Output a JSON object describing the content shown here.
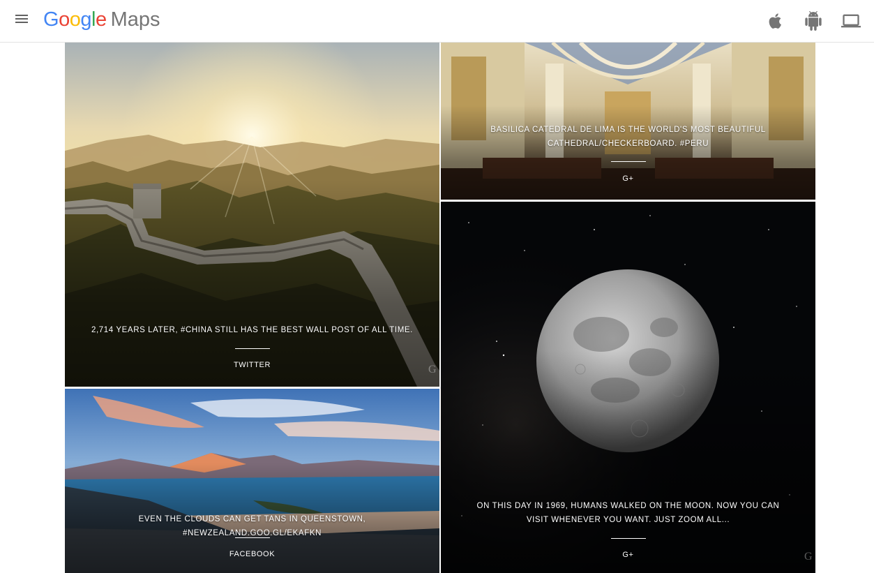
{
  "header": {
    "logo_letters": [
      "G",
      "o",
      "o",
      "g",
      "l",
      "e"
    ],
    "logo_suffix": "Maps",
    "icons": [
      "menu-icon",
      "apple-icon",
      "android-icon",
      "laptop-icon"
    ]
  },
  "colors": {
    "google_blue": "#4285f4",
    "google_red": "#ea4335",
    "google_yellow": "#fbbc05",
    "google_green": "#34a853"
  },
  "tiles": [
    {
      "caption": "2,714 years later, #China still has the best wall post of all time.",
      "source": "TWITTER"
    },
    {
      "caption": "Basilica Catedral de Lima is the world's most beautiful cathedral/checkerboard. #Peru",
      "source": "G+"
    },
    {
      "caption": "Even the clouds can get tans in Queenstown, #NewZealand.goo.gl/EkAfKn",
      "source": "FACEBOOK"
    },
    {
      "caption": "On this day in 1969, humans walked on the moon. Now you can visit whenever you want. Just zoom all...",
      "source": "G+"
    }
  ]
}
